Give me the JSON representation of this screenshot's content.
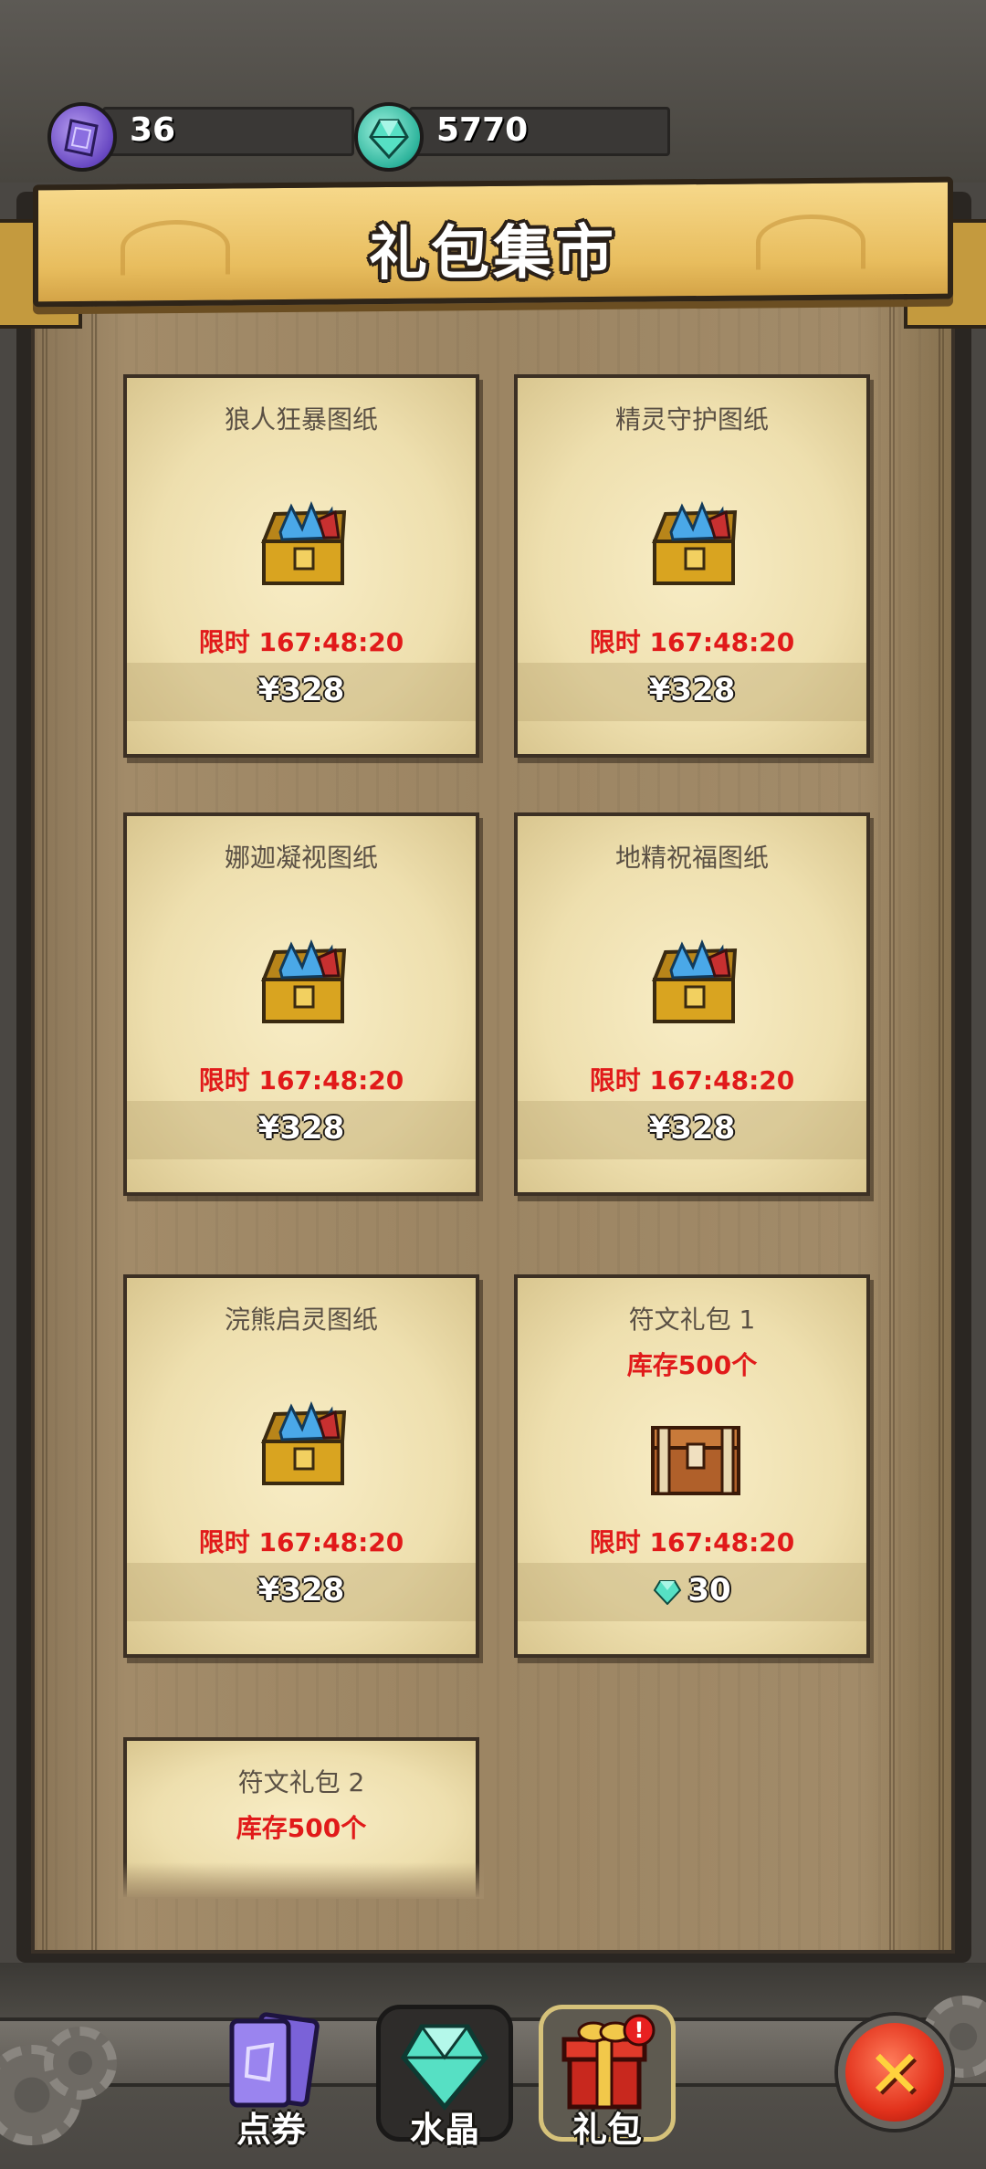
{
  "resources": {
    "tickets": {
      "icon": "ticket-icon",
      "value": "36"
    },
    "crystals": {
      "icon": "crystal-icon",
      "value": "5770"
    }
  },
  "title": "礼包集市",
  "cards": [
    {
      "name": "狼人狂暴图纸",
      "timer": "限时 167:48:20",
      "price": "¥328",
      "icon": "treasure-chest-icon"
    },
    {
      "name": "精灵守护图纸",
      "timer": "限时 167:48:20",
      "price": "¥328",
      "icon": "treasure-chest-icon"
    },
    {
      "name": "娜迦凝视图纸",
      "timer": "限时 167:48:20",
      "price": "¥328",
      "icon": "treasure-chest-icon"
    },
    {
      "name": "地精祝福图纸",
      "timer": "限时 167:48:20",
      "price": "¥328",
      "icon": "treasure-chest-icon"
    },
    {
      "name": "浣熊启灵图纸",
      "timer": "限时 167:48:20",
      "price": "¥328",
      "icon": "treasure-chest-icon"
    },
    {
      "name": "符文礼包 1",
      "stock": "库存500个",
      "timer": "限时 167:48:20",
      "price": "30",
      "icon": "wooden-chest-icon",
      "price_icon": "crystal-icon"
    },
    {
      "name": "符文礼包 2",
      "stock": "库存500个"
    }
  ],
  "tabs": [
    {
      "label": "点券",
      "icon": "ticket-cards-icon",
      "active": false
    },
    {
      "label": "水晶",
      "icon": "crystal-icon",
      "active": false
    },
    {
      "label": "礼包",
      "icon": "gift-box-icon",
      "active": true
    }
  ],
  "close_icon": "close-icon",
  "colors": {
    "timer_red": "#e11a1a",
    "banner_gold": "#e8bd5e",
    "crystal_teal": "#2eb49c",
    "ticket_purple": "#6848c2"
  }
}
